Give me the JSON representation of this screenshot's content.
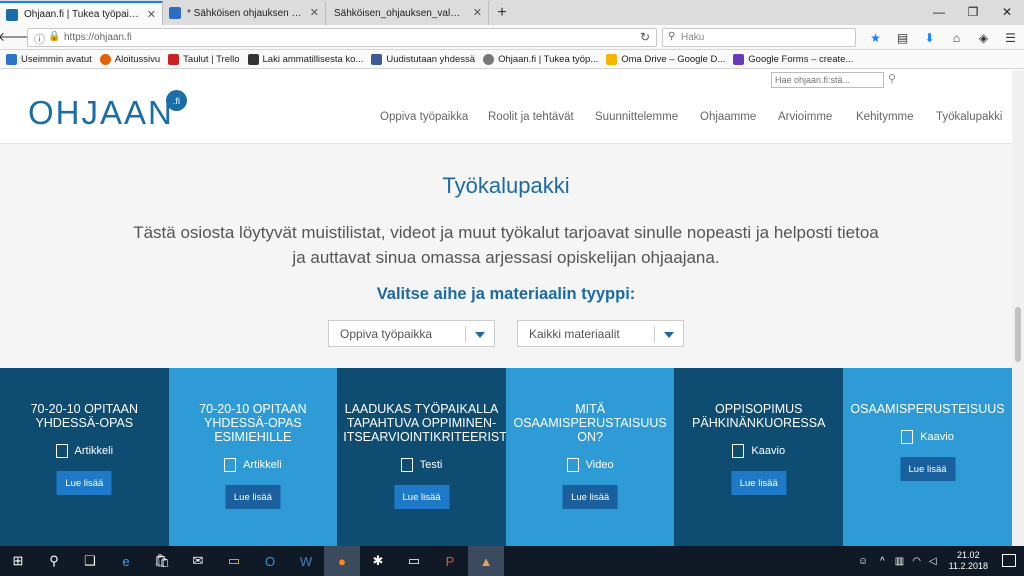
{
  "browser": {
    "tabs": [
      {
        "title": "Ohjaan.fi | Tukea työpaikkaohjaukseen",
        "active": true
      },
      {
        "title": "* Sähköisen ohjauksen VALMENNUS",
        "active": false
      },
      {
        "title": "Sähköisen_ohjauksen_valmennus",
        "active": false
      }
    ],
    "new_tab_symbol": "+",
    "window_controls": [
      "—",
      "❐",
      "✕"
    ],
    "url": "https://ohjaan.fi",
    "search_placeholder": "Haku",
    "bookmarks": [
      {
        "label": "Useimmin avatut",
        "color": "#2b73c8"
      },
      {
        "label": "Aloitussivu",
        "color": "#e66000"
      },
      {
        "label": "Taulut | Trello",
        "color": "#cc2222"
      },
      {
        "label": "Laki ammatillisesta ko...",
        "color": "#333333"
      },
      {
        "label": "Uudistutaan yhdessä",
        "color": "#3b5998"
      },
      {
        "label": "Ohjaan.fi | Tukea työp...",
        "color": "#777777"
      },
      {
        "label": "Oma Drive – Google D...",
        "color": "#f4b400"
      },
      {
        "label": "Google Forms – create...",
        "color": "#673ab7"
      }
    ]
  },
  "site": {
    "logo_text": "OHJAAN",
    "logo_badge": ".fi",
    "search_placeholder": "Hae ohjaan.fi:stä...",
    "nav": [
      "Oppiva työpaikka",
      "Roolit ja tehtävät",
      "Suunnittelemme",
      "Ohjaamme",
      "Arvioimme",
      "Kehitymme",
      "Työkalupakki"
    ],
    "page_title": "Työkalupakki",
    "intro": "Tästä osiosta löytyvät muistilistat, videot ja muut työkalut tarjoavat sinulle nopeasti ja helposti tietoa ja auttavat sinua omassa arjessasi opiskelijan ohjaajana.",
    "filter_heading": "Valitse aihe ja materiaalin tyyppi:",
    "filter_topic": "Oppiva työpaikka",
    "filter_type": "Kaikki materiaalit",
    "cards": [
      {
        "title": "70-20-10 opitaan yhdessä-opas",
        "type": "Artikkeli",
        "icon": "document-icon",
        "button": "Lue lisää",
        "bg": "#0e4c72",
        "btn_bg": "#1e7ac8"
      },
      {
        "title": "70-20-10 opitaan yhdessä-opas esimiehille",
        "type": "Artikkeli",
        "icon": "document-icon",
        "button": "Lue lisää",
        "bg": "#2e9bd6",
        "btn_bg": "#1a5f9e"
      },
      {
        "title": "Laadukas työpaikalla tapahtuva oppiminen-itsearviointikriteeristö",
        "type": "Testi",
        "icon": "checklist-icon",
        "button": "Lue lisää",
        "bg": "#0e4c72",
        "btn_bg": "#1e7ac8"
      },
      {
        "title": "Mitä osaamisperustaisuus on?",
        "type": "Video",
        "icon": "video-icon",
        "button": "Lue lisää",
        "bg": "#2e9bd6",
        "btn_bg": "#1a5f9e"
      },
      {
        "title": "Oppisopimus pähkinänkuoressa",
        "type": "Kaavio",
        "icon": "image-icon",
        "button": "Lue lisää",
        "bg": "#0e4c72",
        "btn_bg": "#1e7ac8"
      },
      {
        "title": "Osaamisperusteisuus",
        "type": "Kaavio",
        "icon": "image-icon",
        "button": "Lue lisää",
        "bg": "#2e9bd6",
        "btn_bg": "#1a5f9e"
      }
    ]
  },
  "taskbar": {
    "apps": [
      "windows-start-icon",
      "search-icon",
      "task-view-icon",
      "edge-icon",
      "store-icon",
      "mail-icon",
      "file-explorer-icon",
      "outlook-icon",
      "word-icon",
      "firefox-icon",
      "app-icon",
      "window-icon",
      "powerpoint-icon",
      "photos-icon"
    ],
    "time": "21.02",
    "date": "11.2.2018"
  }
}
